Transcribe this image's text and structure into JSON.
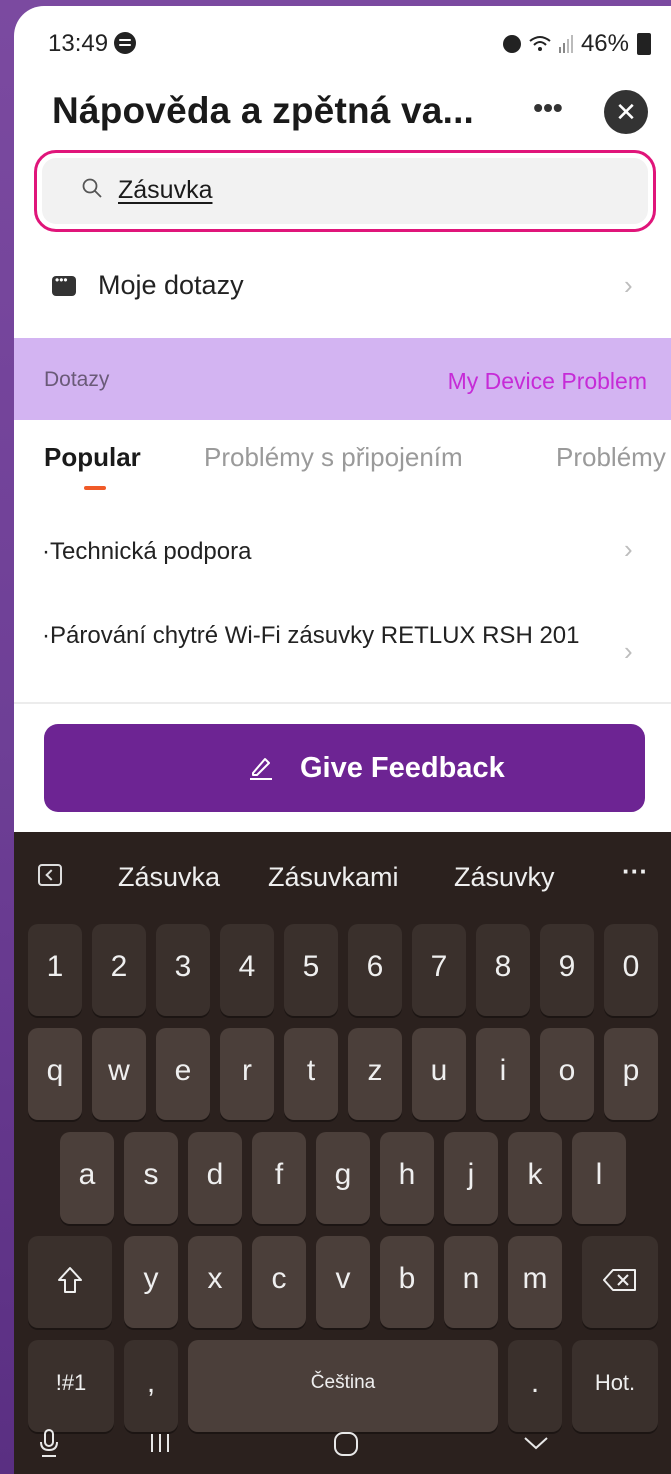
{
  "status_bar": {
    "time": "13:49",
    "battery": "46%"
  },
  "header": {
    "title": "Nápověda a zpětná va...",
    "more_label": "•••",
    "close_label": "✕"
  },
  "search": {
    "value": "Zásuvka"
  },
  "my_questions": {
    "label": "Moje dotazy"
  },
  "faq_band": {
    "label": "Dotazy",
    "link": "My Device Problem"
  },
  "tabs": [
    {
      "label": "Popular"
    },
    {
      "label": "Problémy s připojením"
    },
    {
      "label": "Problémy"
    }
  ],
  "faq_items": [
    {
      "text": "·Technická podpora"
    },
    {
      "text": "·Párování chytré Wi-Fi zásuvky RETLUX RSH 201"
    }
  ],
  "feedback": {
    "label": "Give Feedback"
  },
  "keyboard": {
    "suggestions": [
      "Zásuvka",
      "Zásuvkami",
      "Zásuvky"
    ],
    "more": "···",
    "row_numbers": [
      "1",
      "2",
      "3",
      "4",
      "5",
      "6",
      "7",
      "8",
      "9",
      "0"
    ],
    "row_top": [
      "q",
      "w",
      "e",
      "r",
      "t",
      "z",
      "u",
      "i",
      "o",
      "p"
    ],
    "row_mid": [
      "a",
      "s",
      "d",
      "f",
      "g",
      "h",
      "j",
      "k",
      "l"
    ],
    "row_bottom": [
      "y",
      "x",
      "c",
      "v",
      "b",
      "n",
      "m"
    ],
    "symbols_key": "!#1",
    "comma_key": ",",
    "space_label": "Čeština",
    "period_key": ".",
    "enter_label": "Hot."
  }
}
